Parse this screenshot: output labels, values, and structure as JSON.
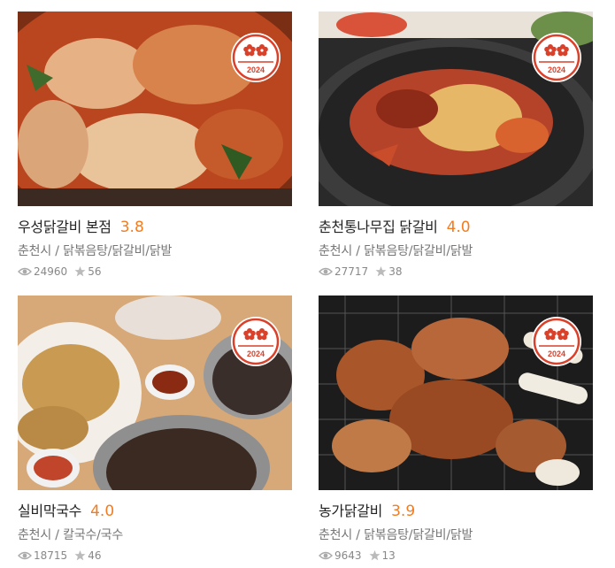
{
  "badge_year": "2024",
  "restaurants": [
    {
      "name": "우성닭갈비 본점",
      "rating": "3.8",
      "region": "춘천시",
      "category": "닭볶음탕/닭갈비/닭발",
      "views": "24960",
      "stars": "56"
    },
    {
      "name": "춘천통나무집 닭갈비",
      "rating": "4.0",
      "region": "춘천시",
      "category": "닭볶음탕/닭갈비/닭발",
      "views": "27717",
      "stars": "38"
    },
    {
      "name": "실비막국수",
      "rating": "4.0",
      "region": "춘천시",
      "category": "칼국수/국수",
      "views": "18715",
      "stars": "46"
    },
    {
      "name": "농가닭갈비",
      "rating": "3.9",
      "region": "춘천시",
      "category": "닭볶음탕/닭갈비/닭발",
      "views": "9643",
      "stars": "13"
    }
  ],
  "colors": {
    "rating": "#f47c20",
    "badge": "#d9412b"
  }
}
